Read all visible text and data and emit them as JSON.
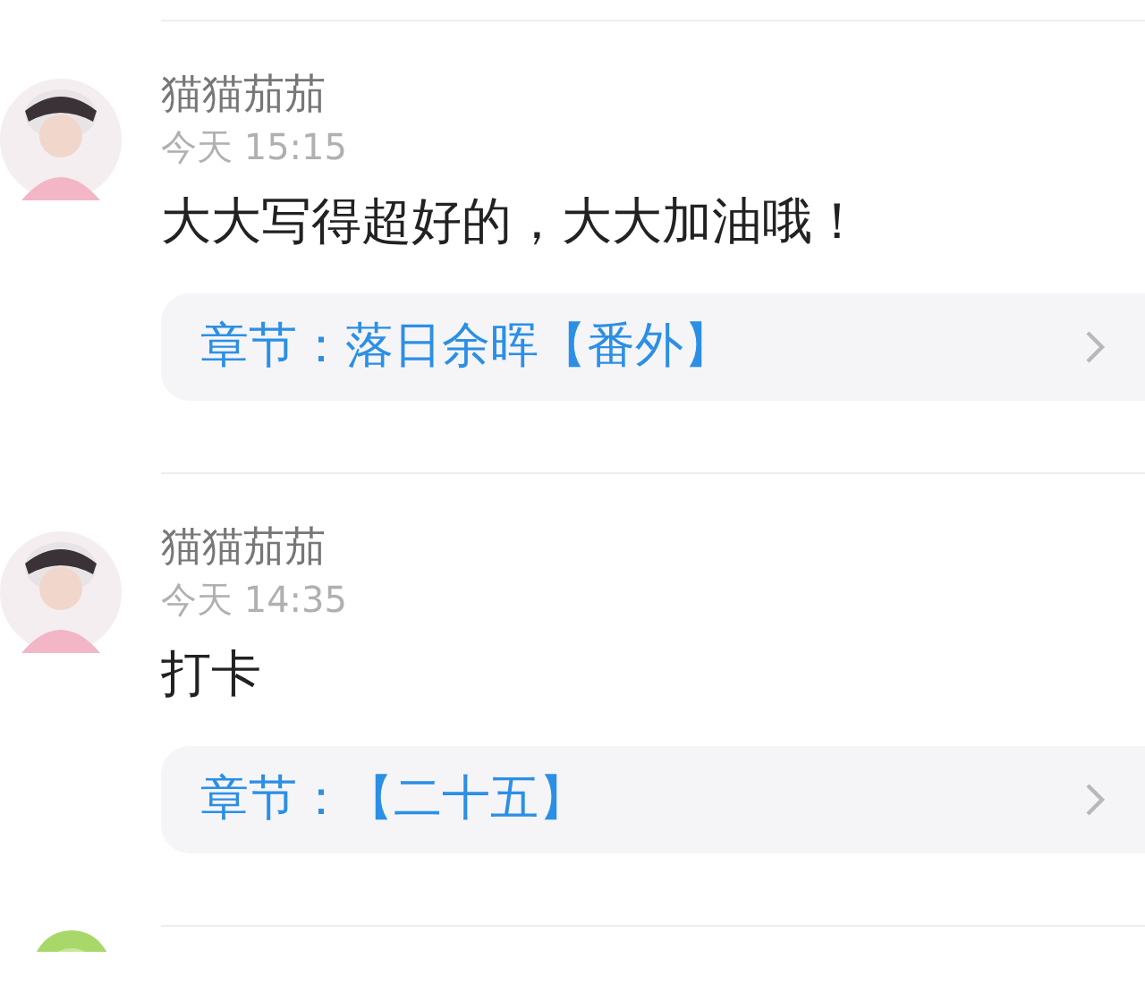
{
  "comments": [
    {
      "user": "猫猫茄茄",
      "time": "今天 15:15",
      "text": "大大写得超好的，大大加油哦！",
      "chapter": "章节：落日余晖【番外】"
    },
    {
      "user": "猫猫茄茄",
      "time": "今天 14:35",
      "text": "打卡",
      "chapter": "章节：【二十五】"
    }
  ]
}
